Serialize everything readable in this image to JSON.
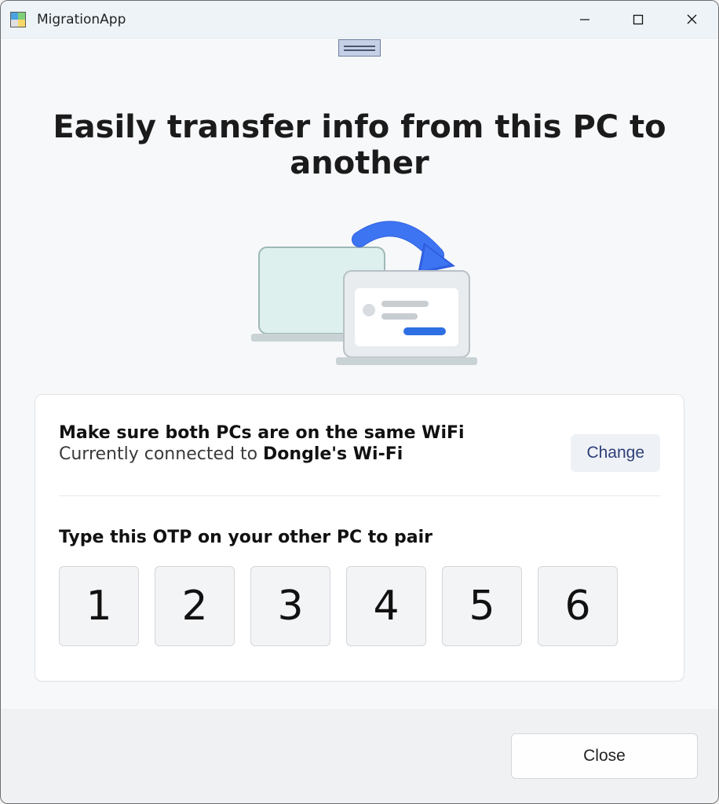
{
  "titlebar": {
    "app_name": "MigrationApp"
  },
  "page": {
    "title": "Easily transfer info from this PC to another"
  },
  "card": {
    "wifi_heading": "Make sure both PCs are on the same WiFi",
    "wifi_connected_prefix": "Currently connected to ",
    "wifi_network_name": "Dongle's Wi-Fi",
    "change_label": "Change",
    "otp_heading": "Type this OTP on your other PC to pair",
    "otp_digits": [
      "1",
      "2",
      "3",
      "4",
      "5",
      "6"
    ]
  },
  "footer": {
    "close_label": "Close"
  }
}
